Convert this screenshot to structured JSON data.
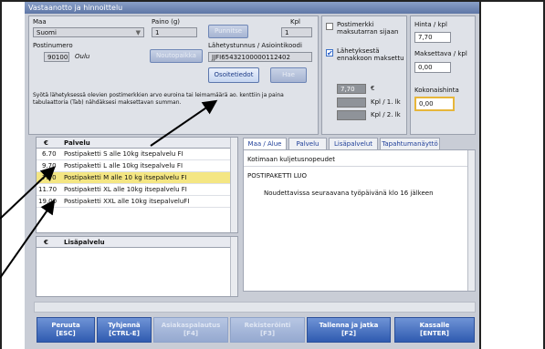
{
  "window": {
    "title": "Vastaanotto ja hinnoittelu"
  },
  "form": {
    "maa_label": "Maa",
    "maa_value": "Suomi",
    "paino_label": "Paino (g)",
    "paino_value": "1",
    "punnitse_label": "Punnitse",
    "kpl_label": "Kpl",
    "kpl_value": "1",
    "postinumero_label": "Postinumero",
    "postinumero_value": "90100",
    "city": "Oulu",
    "noutopaikka_label": "Noutopaikka",
    "tunnus_label": "Lähetystunnus / Asiointikoodi",
    "tunnus_value": "JJFI65432100000112402",
    "osoitetiedot_label": "Osoitetiedot",
    "hae_label": "Hae",
    "note": "Syötä lähetyksessä olevien postimerkkien arvo euroina tai leimamäärä ao. kenttiin ja paina tabulaattoria (Tab) nähdäksesi maksettavan summan."
  },
  "stamps": {
    "postimerkki_label": "Postimerkki maksutarran sijaan",
    "lahetyksesta_label": "Lähetyksestä ennakkoon maksettu",
    "amount_value": "7,70",
    "currency": "€",
    "kpl1_label": "Kpl / 1. lk",
    "kpl2_label": "Kpl / 2. lk"
  },
  "pricing": {
    "hinta_label": "Hinta / kpl",
    "hinta_value": "7,70",
    "maksettava_label": "Maksettava / kpl",
    "maksettava_value": "0,00",
    "kokonais_label": "Kokonaishinta",
    "kokonais_value": "0,00"
  },
  "services_table": {
    "col_price": "€",
    "col_name": "Palvelu",
    "rows": [
      {
        "price": "6.70",
        "name": "Postipaketti S alle 10kg itsepalvelu FI"
      },
      {
        "price": "9.70",
        "name": "Postipaketti L alle 10kg itsepalvelu FI"
      },
      {
        "price": "7.70",
        "name": "Postipaketti M alle 10 kg itsepalvelu FI"
      },
      {
        "price": "11.70",
        "name": "Postipaketti XL alle 10kg itsepalvelu FI"
      },
      {
        "price": "19.00",
        "name": "Postipaketti XXL alle 10kg itsepalveluFI"
      }
    ]
  },
  "addon_table": {
    "col_price": "€",
    "col_name": "Lisäpalvelu"
  },
  "tabs": [
    "Maa / Alue",
    "Palvelu",
    "Lisäpalvelut",
    "Tapahtumanäyttö"
  ],
  "info": {
    "line1": "Kotimaan kuljetusnopeudet",
    "line2": "POSTIPAKETTI LUO",
    "line3": "Noudettavissa seuraavana työpäivänä klo 16 jälkeen"
  },
  "buttons": {
    "peruuta": "Peruuta",
    "peruuta_key": "[ESC]",
    "tyhjenna": "Tyhjennä",
    "tyhjenna_key": "[CTRL-E]",
    "asiakaspalautus": "Asiakaspalautus",
    "asiakaspalautus_key": "[F4]",
    "rekisterointi": "Rekisteröinti",
    "rekisterointi_key": "[F3]",
    "tallenna": "Tallenna ja jatka",
    "tallenna_key": "[F2]",
    "kassalle": "Kassalle",
    "kassalle_key": "[ENTER]"
  }
}
